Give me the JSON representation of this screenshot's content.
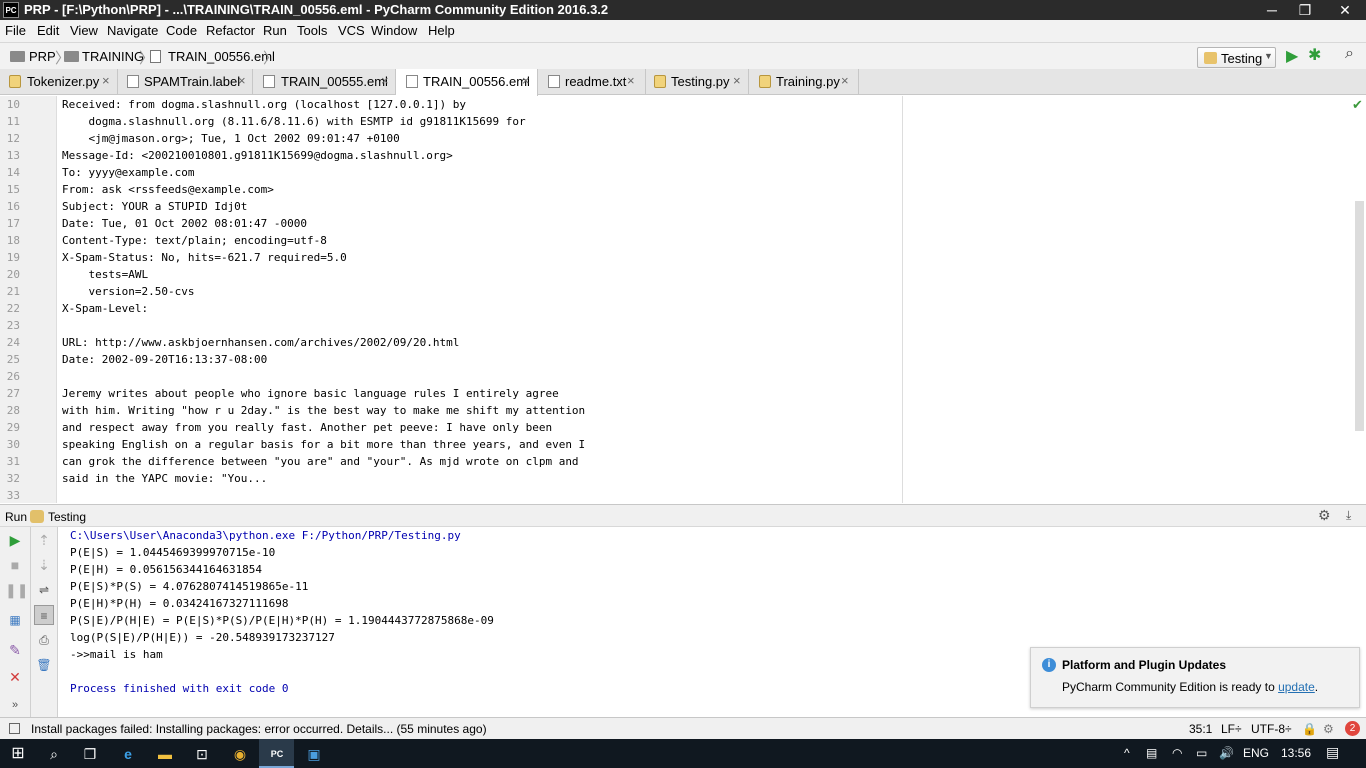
{
  "window": {
    "app_icon": "PC",
    "title": "PRP - [F:\\Python\\PRP] - ...\\TRAINING\\TRAIN_00556.eml - PyCharm Community Edition 2016.3.2",
    "minimize": "─",
    "maximize": "❐",
    "close": "✕"
  },
  "menu": [
    "File",
    "Edit",
    "View",
    "Navigate",
    "Code",
    "Refactor",
    "Run",
    "Tools",
    "VCS",
    "Window",
    "Help"
  ],
  "breadcrumb": [
    "PRP",
    "TRAINING",
    "TRAIN_00556.eml"
  ],
  "run_config": {
    "label": "Testing"
  },
  "tabs": [
    {
      "label": "Tokenizer.py",
      "icon": "python-file-icon"
    },
    {
      "label": "SPAMTrain.label",
      "icon": "text-file-icon"
    },
    {
      "label": "TRAIN_00555.eml",
      "icon": "text-file-icon"
    },
    {
      "label": "TRAIN_00556.eml",
      "icon": "text-file-icon",
      "active": true
    },
    {
      "label": "readme.txt",
      "icon": "text-file-icon"
    },
    {
      "label": "Testing.py",
      "icon": "python-file-icon"
    },
    {
      "label": "Training.py",
      "icon": "python-file-icon"
    }
  ],
  "editor": {
    "lines": [
      {
        "n": "10",
        "text": "Received: from dogma.slashnull.org (localhost [127.0.0.1]) by"
      },
      {
        "n": "11",
        "text": "    dogma.slashnull.org (8.11.6/8.11.6) with ESMTP id g91811K15699 for"
      },
      {
        "n": "12",
        "text": "    <jm@jmason.org>; Tue, 1 Oct 2002 09:01:47 +0100"
      },
      {
        "n": "13",
        "text": "Message-Id: <200210010801.g91811K15699@dogma.slashnull.org>"
      },
      {
        "n": "14",
        "text": "To: yyyy@example.com"
      },
      {
        "n": "15",
        "text": "From: ask <rssfeeds@example.com>"
      },
      {
        "n": "16",
        "text": "Subject: YOUR a STUPID Idj0t"
      },
      {
        "n": "17",
        "text": "Date: Tue, 01 Oct 2002 08:01:47 -0000"
      },
      {
        "n": "18",
        "text": "Content-Type: text/plain; encoding=utf-8"
      },
      {
        "n": "19",
        "text": "X-Spam-Status: No, hits=-621.7 required=5.0"
      },
      {
        "n": "20",
        "text": "    tests=AWL"
      },
      {
        "n": "21",
        "text": "    version=2.50-cvs"
      },
      {
        "n": "22",
        "text": "X-Spam-Level:"
      },
      {
        "n": "23",
        "text": ""
      },
      {
        "n": "24",
        "text": "URL: http://www.askbjoernhansen.com/archives/2002/09/20.html"
      },
      {
        "n": "25",
        "text": "Date: 2002-09-20T16:13:37-08:00"
      },
      {
        "n": "26",
        "text": ""
      },
      {
        "n": "27",
        "text": "Jeremy writes about people who ignore basic language rules I entirely agree"
      },
      {
        "n": "28",
        "text": "with him. Writing \"how r u 2day.\" is the best way to make me shift my attention"
      },
      {
        "n": "29",
        "text": "and respect away from you really fast. Another pet peeve: I have only been"
      },
      {
        "n": "30",
        "text": "speaking English on a regular basis for a bit more than three years, and even I"
      },
      {
        "n": "31",
        "text": "can grok the difference between \"you are\" and \"your\". As mjd wrote on clpm and"
      },
      {
        "n": "32",
        "text": "said in the YAPC movie: \"You..."
      },
      {
        "n": "33",
        "text": ""
      }
    ]
  },
  "run_panel": {
    "label": "Run",
    "config": "Testing",
    "output": [
      {
        "text": "C:\\Users\\User\\Anaconda3\\python.exe F:/Python/PRP/Testing.py",
        "style": "blue"
      },
      {
        "text": "P(E|S) = 1.0445469399970715e-10",
        "style": "normal"
      },
      {
        "text": "P(E|H) = 0.056156344164631854",
        "style": "normal"
      },
      {
        "text": "P(E|S)*P(S) = 4.0762807414519865e-11",
        "style": "normal"
      },
      {
        "text": "P(E|H)*P(H) = 0.03424167327111698",
        "style": "normal"
      },
      {
        "text": "P(S|E)/P(H|E) = P(E|S)*P(S)/P(E|H)*P(H) = 1.1904443772875868e-09",
        "style": "normal"
      },
      {
        "text": "log(P(S|E)/P(H|E)) = -20.548939173237127",
        "style": "normal"
      },
      {
        "text": "->>mail is ham",
        "style": "normal"
      },
      {
        "text": "",
        "style": "normal"
      },
      {
        "text": "Process finished with exit code 0",
        "style": "blue"
      }
    ]
  },
  "notification": {
    "title": "Platform and Plugin Updates",
    "body": "PyCharm Community Edition is ready to ",
    "link": "update",
    "end": "."
  },
  "status_bar": {
    "message": "Install packages failed: Installing packages: error occurred. Details... (55 minutes ago)",
    "position": "35:1",
    "line_sep": "LF÷",
    "encoding": "UTF-8÷",
    "event_count": "2"
  },
  "taskbar": {
    "lang": "ENG",
    "time": "13:56"
  },
  "colors": {
    "accent": "#2470b3",
    "run_green": "#2f9e3a",
    "error_red": "#e0463d"
  }
}
